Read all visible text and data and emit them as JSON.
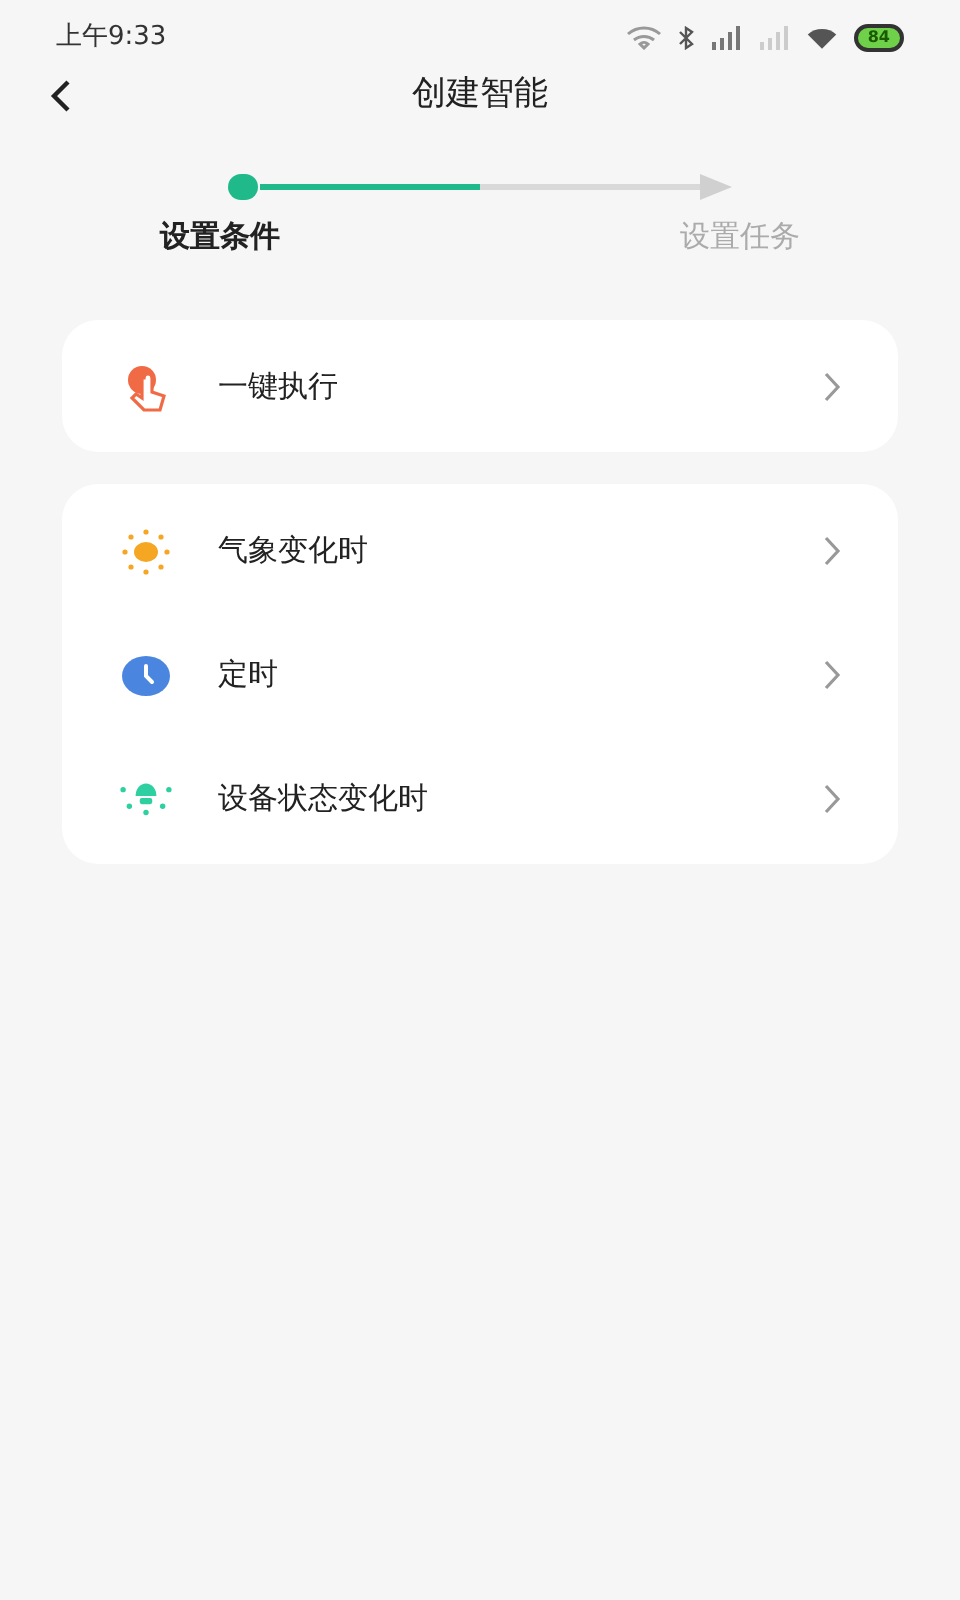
{
  "status_bar": {
    "time": "上午9:33",
    "battery": "84"
  },
  "header": {
    "title": "创建智能"
  },
  "progress": {
    "level": 0.5
  },
  "steps": [
    {
      "label": "设置条件",
      "selected": true
    },
    {
      "label": "设置任务",
      "selected": false
    }
  ],
  "groups": [
    {
      "items": [
        {
          "kind": "hand",
          "label": "一键执行"
        }
      ]
    },
    {
      "items": [
        {
          "kind": "sun",
          "label": "气象变化时"
        },
        {
          "kind": "clock",
          "label": "定时"
        },
        {
          "kind": "bulb",
          "label": "设备状态变化时"
        }
      ]
    }
  ]
}
